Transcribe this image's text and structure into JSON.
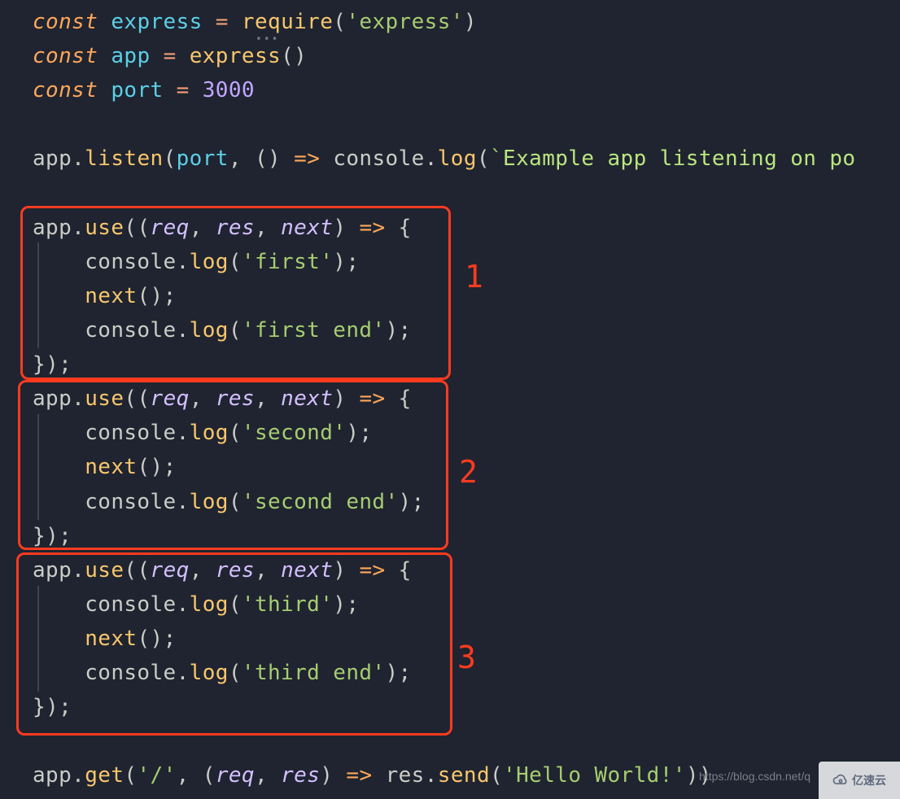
{
  "colors": {
    "background": "#1f2430",
    "highlight_border": "#ff3b1f",
    "keyword": "#ffa759",
    "variable": "#5ccfe6",
    "function": "#f8c66c",
    "string": "#a6cc70",
    "number": "#c3a6ff",
    "param": "#d4bfff",
    "operator": "#f29e74",
    "template": "#bae67e"
  },
  "annotations": {
    "box1": "1",
    "box2": "2",
    "box3": "3"
  },
  "code": {
    "line1": {
      "kw": "const",
      "sp1": " ",
      "var": "express",
      "sp2": " ",
      "op": "=",
      "sp3": " ",
      "fn": "require",
      "lp": "(",
      "str": "'express'",
      "rp": ")"
    },
    "line2": {
      "kw": "const",
      "sp1": " ",
      "var": "app",
      "sp2": " ",
      "op": "=",
      "sp3": " ",
      "fn": "express",
      "lp": "(",
      "rp": ")"
    },
    "line3": {
      "kw": "const",
      "sp1": " ",
      "var": "port",
      "sp2": " ",
      "op": "=",
      "sp3": " ",
      "num": "3000"
    },
    "line4": "",
    "line5": {
      "obj": "app",
      "dot": ".",
      "fn": "listen",
      "lp": "(",
      "var": "port",
      "comma": ", ",
      "lp2": "(",
      "rp2": ")",
      "sp": " ",
      "arrow": "=>",
      "sp2": " ",
      "obj2": "console",
      "dot2": ".",
      "fn2": "log",
      "lp3": "(",
      "bt": "`",
      "tpl": "Example app listening on po"
    },
    "line6": "",
    "blk1": {
      "a": {
        "obj": "app",
        "dot": ".",
        "fn": "use",
        "lp": "(",
        "lp2": "(",
        "p1": "req",
        "c1": ", ",
        "p2": "res",
        "c2": ", ",
        "p3": "next",
        "rp": ")",
        "sp": " ",
        "arrow": "=>",
        "sp2": " ",
        "brace": "{"
      },
      "b": {
        "indent": "    ",
        "obj": "console",
        "dot": ".",
        "fn": "log",
        "lp": "(",
        "str": "'first'",
        "rp": ")",
        "semi": ";"
      },
      "c": {
        "indent": "    ",
        "fn": "next",
        "lp": "(",
        "rp": ")",
        "semi": ";"
      },
      "d": {
        "indent": "    ",
        "obj": "console",
        "dot": ".",
        "fn": "log",
        "lp": "(",
        "str": "'first end'",
        "rp": ")",
        "semi": ";"
      },
      "e": {
        "brace": "}",
        "rp": ")",
        "semi": ";"
      }
    },
    "blk2": {
      "a": {
        "obj": "app",
        "dot": ".",
        "fn": "use",
        "lp": "(",
        "lp2": "(",
        "p1": "req",
        "c1": ", ",
        "p2": "res",
        "c2": ", ",
        "p3": "next",
        "rp": ")",
        "sp": " ",
        "arrow": "=>",
        "sp2": " ",
        "brace": "{"
      },
      "b": {
        "indent": "    ",
        "obj": "console",
        "dot": ".",
        "fn": "log",
        "lp": "(",
        "str": "'second'",
        "rp": ")",
        "semi": ";"
      },
      "c": {
        "indent": "    ",
        "fn": "next",
        "lp": "(",
        "rp": ")",
        "semi": ";"
      },
      "d": {
        "indent": "    ",
        "obj": "console",
        "dot": ".",
        "fn": "log",
        "lp": "(",
        "str": "'second end'",
        "rp": ")",
        "semi": ";"
      },
      "e": {
        "brace": "}",
        "rp": ")",
        "semi": ";"
      }
    },
    "blk3": {
      "a": {
        "obj": "app",
        "dot": ".",
        "fn": "use",
        "lp": "(",
        "lp2": "(",
        "p1": "req",
        "c1": ", ",
        "p2": "res",
        "c2": ", ",
        "p3": "next",
        "rp": ")",
        "sp": " ",
        "arrow": "=>",
        "sp2": " ",
        "brace": "{"
      },
      "b": {
        "indent": "    ",
        "obj": "console",
        "dot": ".",
        "fn": "log",
        "lp": "(",
        "str": "'third'",
        "rp": ")",
        "semi": ";"
      },
      "c": {
        "indent": "    ",
        "fn": "next",
        "lp": "(",
        "rp": ")",
        "semi": ";"
      },
      "d": {
        "indent": "    ",
        "obj": "console",
        "dot": ".",
        "fn": "log",
        "lp": "(",
        "str": "'third end'",
        "rp": ")",
        "semi": ";"
      },
      "e": {
        "brace": "}",
        "rp": ")",
        "semi": ";"
      }
    },
    "line_last": {
      "obj": "app",
      "dot": ".",
      "fn": "get",
      "lp": "(",
      "str": "'/'",
      "c": ", ",
      "lp2": "(",
      "p1": "req",
      "c1": ", ",
      "p2": "res",
      "rp": ")",
      "sp": " ",
      "arrow": "=>",
      "sp2": " ",
      "obj2": "res",
      "dot2": ".",
      "fn2": "send",
      "lp3": "(",
      "str2": "'Hello World!'",
      "rp2": ")",
      "rp3": ")"
    }
  },
  "watermark": "https://blog.csdn.net/q",
  "logo_text": "亿速云"
}
